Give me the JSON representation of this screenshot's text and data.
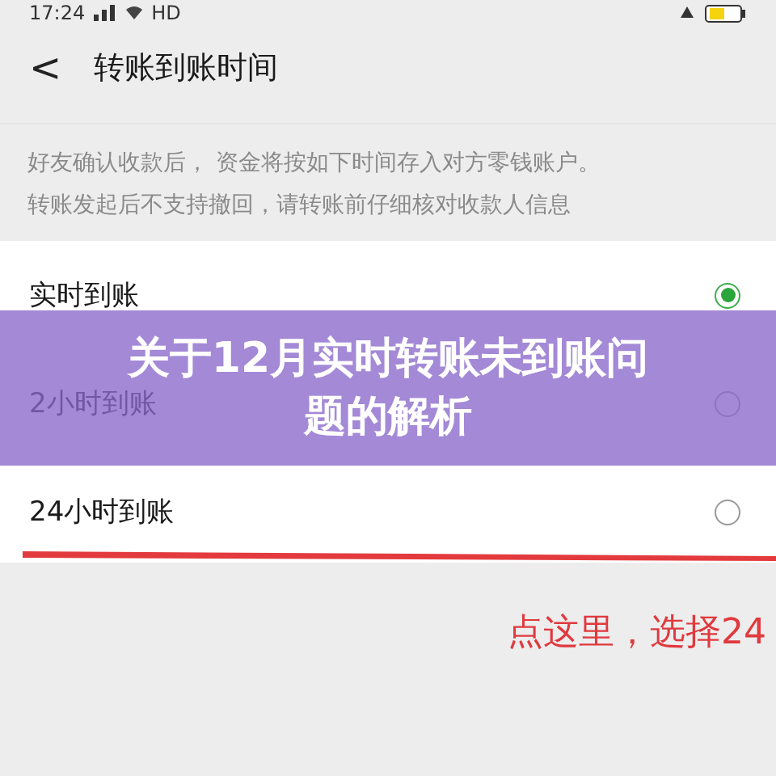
{
  "status_bar": {
    "time": "17:24",
    "network": "HD"
  },
  "header": {
    "back": "<",
    "title": "转账到账时间"
  },
  "notice": [
    "好友确认收款后， 资金将按如下时间存入对方零钱账户。",
    "转账发起后不支持撤回，请转账前仔细核对收款人信息"
  ],
  "options": [
    {
      "label": "实时到账",
      "selected": true
    },
    {
      "label": "2小时到账",
      "selected": false
    },
    {
      "label": "24小时到账",
      "selected": false
    }
  ],
  "annotation": "点这里，选择24",
  "banner": {
    "title_lines": [
      "关于12月实时转账未到账问",
      "题的解析"
    ]
  }
}
